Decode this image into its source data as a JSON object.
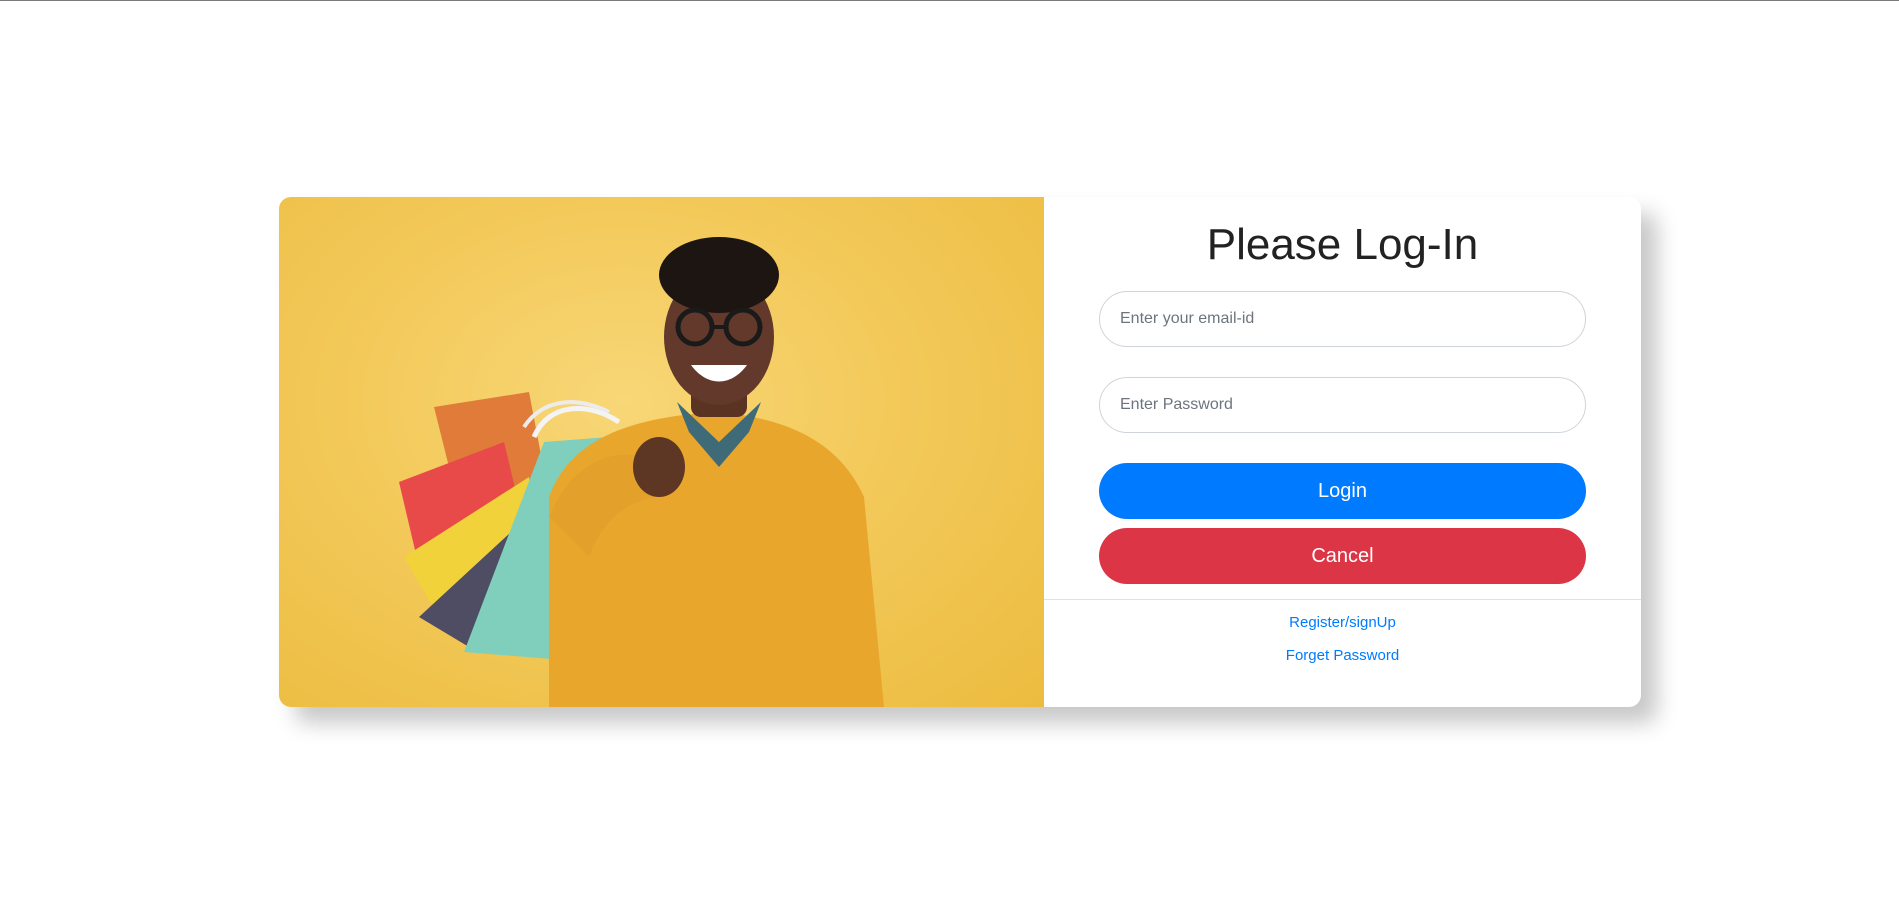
{
  "login_card": {
    "title": "Please Log-In",
    "email": {
      "value": "",
      "placeholder": "Enter your email-id"
    },
    "password": {
      "value": "",
      "placeholder": "Enter Password"
    },
    "login_button": "Login",
    "cancel_button": "Cancel",
    "links": {
      "register": "Register/signUp",
      "forget_password": "Forget Password"
    }
  },
  "hero_image": {
    "subject": "smiling man with glasses in mustard sweater holding colorful shopping bags"
  },
  "colors": {
    "primary": "#007bff",
    "danger": "#dc3545",
    "photo_background": "#f3c95a",
    "title_text": "#222222"
  }
}
